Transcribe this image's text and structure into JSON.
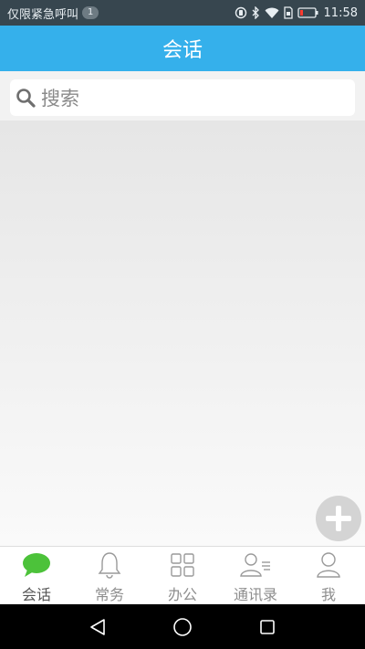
{
  "status_bar": {
    "emergency_text": "仅限紧急呼叫",
    "notification_count": "1",
    "time": "11:58"
  },
  "header": {
    "title": "会话"
  },
  "search": {
    "placeholder": "搜索"
  },
  "tabs": [
    {
      "label": "会话",
      "icon": "chat-bubble-icon",
      "active": true
    },
    {
      "label": "常务",
      "icon": "bell-icon",
      "active": false
    },
    {
      "label": "办公",
      "icon": "grid-icon",
      "active": false
    },
    {
      "label": "通讯录",
      "icon": "contacts-icon",
      "active": false
    },
    {
      "label": "我",
      "icon": "person-icon",
      "active": false
    }
  ],
  "colors": {
    "header": "#35b0eb",
    "status_bar": "#37464f",
    "active_tab_icon": "#4cc23a",
    "fab": "#d4d4d4"
  }
}
